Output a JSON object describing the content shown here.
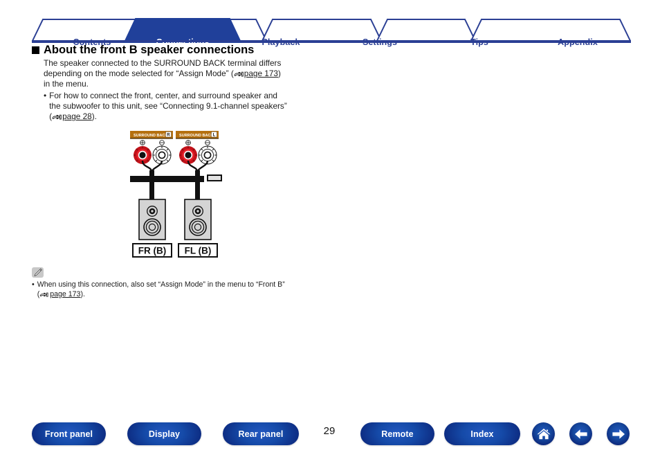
{
  "tabs": [
    {
      "label": "Contents",
      "active": false
    },
    {
      "label": "Connections",
      "active": true
    },
    {
      "label": "Playback",
      "active": false
    },
    {
      "label": "Settings",
      "active": false
    },
    {
      "label": "Tips",
      "active": false
    },
    {
      "label": "Appendix",
      "active": false
    }
  ],
  "heading": "About the front B speaker connections",
  "paragraph": {
    "line1": "The speaker connected to the SURROUND BACK terminal differs",
    "line2_a": "depending on the mode selected for “Assign Mode” (",
    "line2_link": "page 173",
    "line2_b": ")",
    "line3": "in the menu."
  },
  "bullet": {
    "marker": "•",
    "line1": "For how to connect the front, center, and surround speaker and",
    "line2": "the subwoofer to this unit, see “Connecting 9.1-channel speakers”",
    "line3_a": "(",
    "line3_link": "page 28",
    "line3_b": ")."
  },
  "diagram": {
    "terminal_left_label": "SURROUND BACK",
    "terminal_left_channel": "R",
    "terminal_right_label": "SURROUND BACK",
    "terminal_right_channel": "L",
    "plus_symbol": "⊕",
    "minus_symbol": "⊖",
    "speaker_left_label": "FR (B)",
    "speaker_right_label": "FL (B)"
  },
  "note": {
    "icon": "pencil-icon",
    "marker": "•",
    "line1": "When using this connection, also set “Assign Mode” in the menu to “Front B”",
    "line2_a": "(",
    "line2_link": "page 173",
    "line2_b": ")."
  },
  "footer": {
    "buttons": [
      {
        "label": "Front panel"
      },
      {
        "label": "Display"
      },
      {
        "label": "Rear panel"
      },
      {
        "label": "Remote"
      },
      {
        "label": "Index"
      }
    ],
    "page_number": "29",
    "icons": [
      {
        "name": "home-icon"
      },
      {
        "name": "back-arrow-icon"
      },
      {
        "name": "forward-arrow-icon"
      }
    ]
  },
  "colors": {
    "brand_blue": "#2b3f94",
    "tab_active_bg": "#20409a",
    "terminal_band": "#b5700f",
    "positive_red": "#c4121a"
  }
}
